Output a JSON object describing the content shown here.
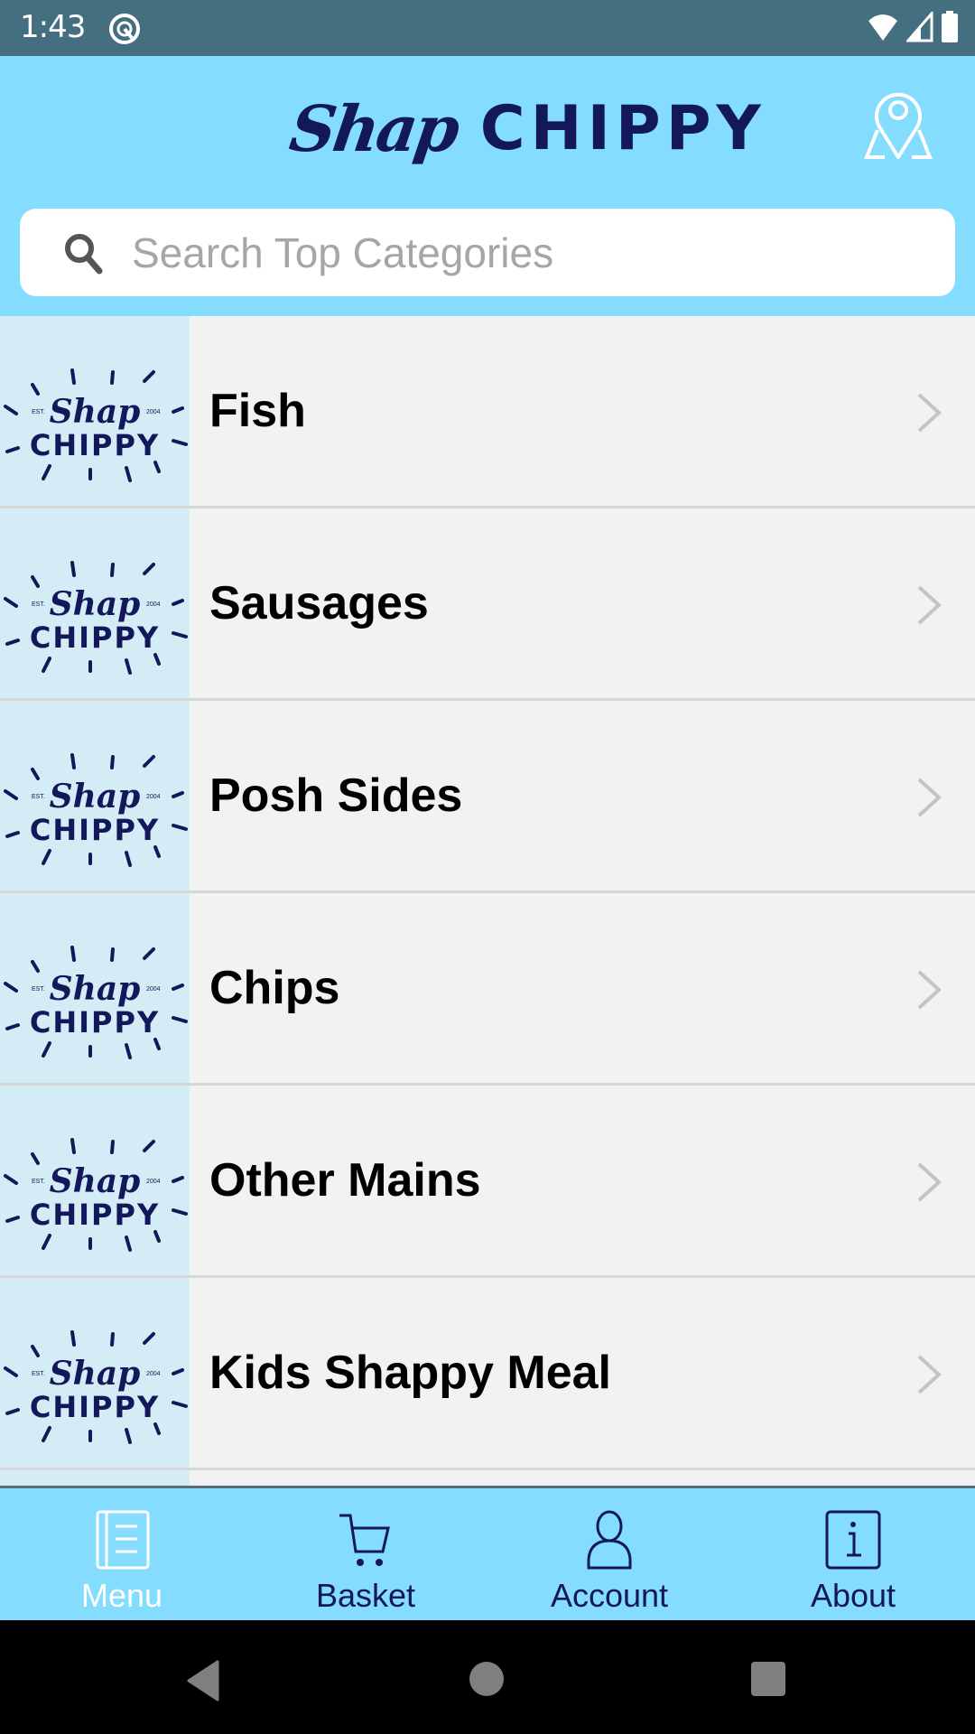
{
  "status_bar": {
    "time": "1:43",
    "icons": [
      "data-saver-icon",
      "wifi-icon",
      "signal-icon",
      "battery-icon"
    ]
  },
  "header": {
    "brand_script": "Shap",
    "brand_bold": "CHIPPY",
    "location_icon": "location-pin-map-icon"
  },
  "search": {
    "placeholder": "Search Top Categories",
    "value": ""
  },
  "tile_logo": {
    "script": "Shap",
    "bold": "CHIPPY",
    "est": "EST.",
    "year": "2004"
  },
  "categories": [
    {
      "label": "Fish"
    },
    {
      "label": "Sausages"
    },
    {
      "label": "Posh Sides"
    },
    {
      "label": "Chips"
    },
    {
      "label": "Other Mains"
    },
    {
      "label": "Kids Shappy Meal"
    },
    {
      "label": ""
    }
  ],
  "tabs": [
    {
      "label": "Menu",
      "icon": "menu-book-icon",
      "active": true
    },
    {
      "label": "Basket",
      "icon": "cart-icon",
      "active": false
    },
    {
      "label": "Account",
      "icon": "person-icon",
      "active": false
    },
    {
      "label": "About",
      "icon": "info-icon",
      "active": false
    }
  ],
  "colors": {
    "status_bar": "#436f80",
    "header_bg": "#84dcfe",
    "brand_navy": "#13185a",
    "tile_bg": "#d4ecf6",
    "row_bg": "#f2f2f2",
    "active_tab": "#ffffff"
  }
}
